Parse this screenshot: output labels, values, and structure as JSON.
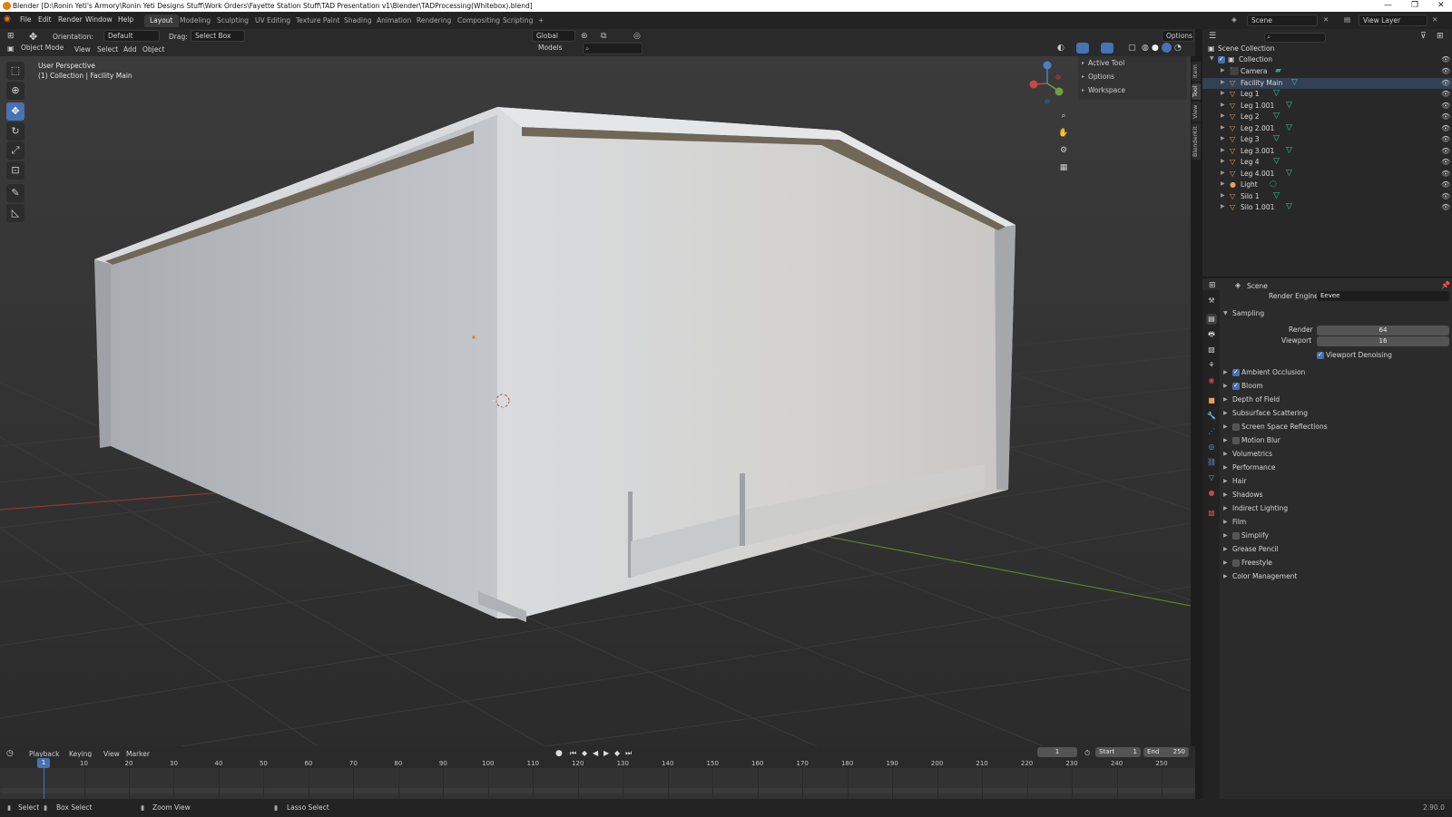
{
  "window": {
    "title": "Blender [D:\\Ronin Yeti's Armory\\Ronin Yeti Designs Stuff\\Work Orders\\Fayette Station Stuff\\TAD Presentation v1\\Blender\\TADProcessing(Whitebox).blend]",
    "minimize": "—",
    "restore": "❐",
    "close": "✕"
  },
  "menu": [
    "File",
    "Edit",
    "Render",
    "Window",
    "Help"
  ],
  "workspaces": [
    "Layout",
    "Modeling",
    "Sculpting",
    "UV Editing",
    "Texture Paint",
    "Shading",
    "Animation",
    "Rendering",
    "Compositing",
    "Scripting",
    "+"
  ],
  "scene_selector": {
    "scene": "Scene",
    "view_layer": "View Layer"
  },
  "tool_header": {
    "orientation_label": "Orientation:",
    "orientation_value": "Default",
    "drag_label": "Drag:",
    "drag_value": "Select Box",
    "transform_global": "Global",
    "options": "Options"
  },
  "viewport_header": {
    "mode": "Object Mode",
    "menus": [
      "View",
      "Select",
      "Add",
      "Object"
    ],
    "collection_filter": "Models"
  },
  "viewport": {
    "perspective": "User Perspective",
    "collection_info": "(1) Collection | Facility Main",
    "colors": {
      "background": "#3d3d3d",
      "grid": "#4a4a4a",
      "x_axis": "#9c3b3b",
      "y_axis": "#6b8a2c",
      "model": "#bdbfc2"
    }
  },
  "n_panel": {
    "items": [
      "Active Tool",
      "Options",
      "Workspace"
    ],
    "tabs": [
      "Item",
      "Tool",
      "View",
      "BlenderKit"
    ]
  },
  "outliner": {
    "root": "Scene Collection",
    "collection": "Collection",
    "items": [
      {
        "name": "Camera",
        "icon": "camera-icon"
      },
      {
        "name": "Facility Main",
        "icon": "mesh-icon"
      },
      {
        "name": "Leg 1",
        "icon": "mesh-icon"
      },
      {
        "name": "Leg 1.001",
        "icon": "mesh-icon"
      },
      {
        "name": "Leg 2",
        "icon": "mesh-icon"
      },
      {
        "name": "Leg 2.001",
        "icon": "mesh-icon"
      },
      {
        "name": "Leg 3",
        "icon": "mesh-icon"
      },
      {
        "name": "Leg 3.001",
        "icon": "mesh-icon"
      },
      {
        "name": "Leg 4",
        "icon": "mesh-icon"
      },
      {
        "name": "Leg 4.001",
        "icon": "mesh-icon"
      },
      {
        "name": "Light",
        "icon": "light-icon"
      },
      {
        "name": "Silo 1",
        "icon": "mesh-icon"
      },
      {
        "name": "Silo 1.001",
        "icon": "mesh-icon"
      }
    ]
  },
  "properties": {
    "header": "Scene",
    "render_engine_label": "Render Engine",
    "render_engine": "Eevee",
    "sampling": {
      "title": "Sampling",
      "render_label": "Render",
      "render_value": "64",
      "viewport_label": "Viewport",
      "viewport_value": "16",
      "denoise_label": "Viewport Denoising",
      "denoise": true
    },
    "panels": [
      {
        "label": "Ambient Occlusion",
        "checkbox": true,
        "checked": true
      },
      {
        "label": "Bloom",
        "checkbox": true,
        "checked": true
      },
      {
        "label": "Depth of Field",
        "checkbox": false,
        "checked": false
      },
      {
        "label": "Subsurface Scattering",
        "checkbox": false,
        "checked": false
      },
      {
        "label": "Screen Space Reflections",
        "checkbox": true,
        "checked": false
      },
      {
        "label": "Motion Blur",
        "checkbox": true,
        "checked": false
      },
      {
        "label": "Volumetrics",
        "checkbox": false,
        "checked": false
      },
      {
        "label": "Performance",
        "checkbox": false,
        "checked": false
      },
      {
        "label": "Hair",
        "checkbox": false,
        "checked": false
      },
      {
        "label": "Shadows",
        "checkbox": false,
        "checked": false
      },
      {
        "label": "Indirect Lighting",
        "checkbox": false,
        "checked": false
      },
      {
        "label": "Film",
        "checkbox": false,
        "checked": false
      },
      {
        "label": "Simplify",
        "checkbox": true,
        "checked": false
      },
      {
        "label": "Grease Pencil",
        "checkbox": false,
        "checked": false
      },
      {
        "label": "Freestyle",
        "checkbox": true,
        "checked": false
      },
      {
        "label": "Color Management",
        "checkbox": false,
        "checked": false
      }
    ]
  },
  "timeline": {
    "menus": [
      "Playback",
      "Keying",
      "View",
      "Marker"
    ],
    "current_frame": "1",
    "start_label": "Start",
    "start": "1",
    "end_label": "End",
    "end": "250",
    "ticks": [
      "1",
      "10",
      "20",
      "30",
      "40",
      "50",
      "60",
      "70",
      "80",
      "90",
      "100",
      "110",
      "120",
      "130",
      "140",
      "150",
      "160",
      "170",
      "180",
      "190",
      "200",
      "210",
      "220",
      "230",
      "240",
      "250"
    ]
  },
  "statusbar": {
    "select": "Select",
    "box_select": "Box Select",
    "zoom_view": "Zoom View",
    "lasso_select": "Lasso Select",
    "version": "2.90.0"
  }
}
